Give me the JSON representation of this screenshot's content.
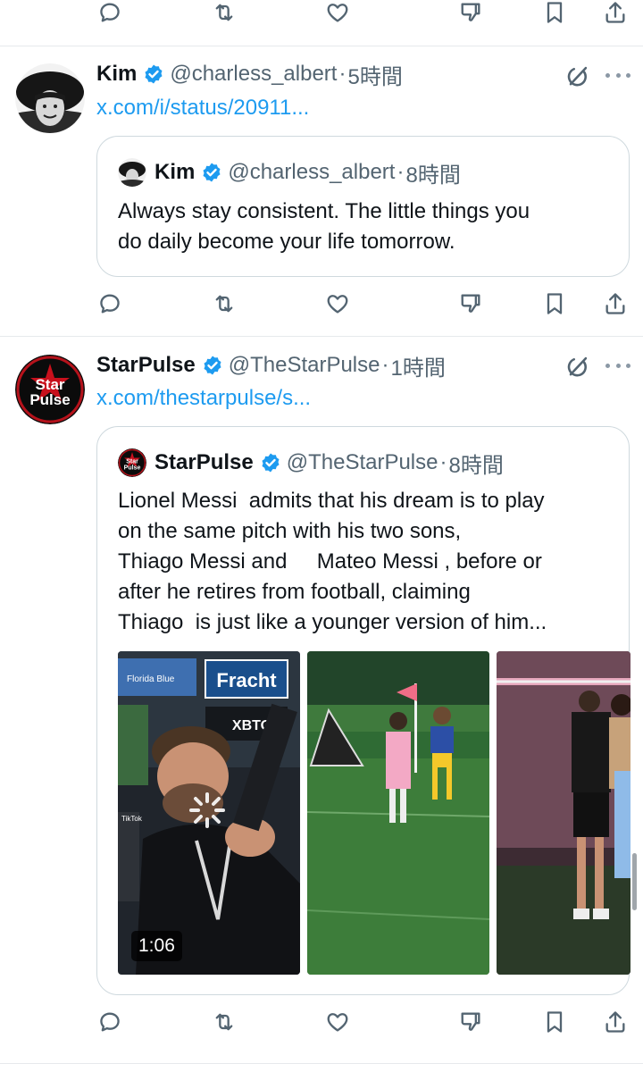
{
  "action_icons": {
    "reply": "reply-icon",
    "repost": "repost-icon",
    "like": "heart-icon",
    "dislike": "thumbs-down-icon",
    "bookmark": "bookmark-icon",
    "share": "share-icon"
  },
  "colors": {
    "verified_badge": "#1d9bf0",
    "link": "#1d9bf0",
    "secondary_text": "#536471",
    "border": "#cfd9de"
  },
  "tweets": [
    {
      "author": {
        "name": "Kim",
        "handle": "@charless_albert",
        "dot": "·",
        "time": "5時間",
        "verified": true
      },
      "link_text": "x.com/i/status/20911...",
      "quote": {
        "author": {
          "name": "Kim",
          "handle": "@charless_albert",
          "dot": "·",
          "time": "8時間"
        },
        "text": "Always stay consistent. The little things you\ndo daily become your life tomorrow."
      }
    },
    {
      "author": {
        "name": "StarPulse",
        "handle": "@TheStarPulse",
        "dot": "·",
        "time": "1時間",
        "verified": true,
        "avatar_text": [
          "Star",
          "Pulse"
        ]
      },
      "link_text": "x.com/thestarpulse/s...",
      "quote": {
        "author": {
          "name": "StarPulse",
          "handle": "@TheStarPulse",
          "dot": "·",
          "time": "8時間"
        },
        "text": "Lionel Messi  admits that his dream is to play\non the same pitch with his two sons,\nThiago Messi and     Mateo Messi , before or\nafter he retires from football, claiming\nThiago  is just like a younger version of him...",
        "media": [
          {
            "type": "video",
            "duration": "1:06",
            "sign_texts": [
              "Fracht",
              "XBTO",
              "Florida Blue"
            ],
            "watermark": "TikTok"
          },
          {
            "type": "photo"
          },
          {
            "type": "photo"
          }
        ]
      }
    }
  ]
}
